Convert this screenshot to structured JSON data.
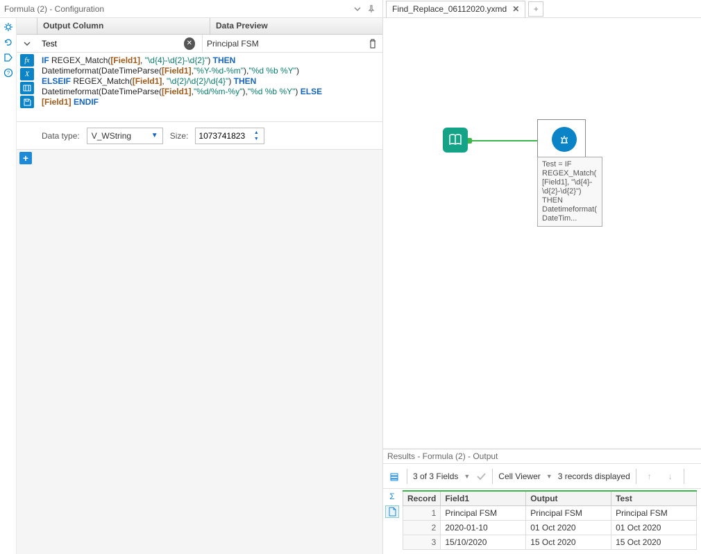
{
  "config": {
    "title": "Formula (2) - Configuration",
    "columns": {
      "output": "Output Column",
      "preview": "Data Preview"
    },
    "row": {
      "output_value": "Test",
      "preview_value": "Principal FSM"
    },
    "expression": {
      "lines": [
        {
          "t": [
            {
              "c": "kw-blue",
              "s": "IF "
            },
            {
              "c": "fn-black",
              "s": "REGEX_Match("
            },
            {
              "c": "field-brown",
              "s": "[Field1]"
            },
            {
              "c": "fn-black",
              "s": ", "
            },
            {
              "c": "str-teal",
              "s": "\"\\d{4}-\\d{2}-\\d{2}\""
            },
            {
              "c": "fn-black",
              "s": ") "
            },
            {
              "c": "kw-blue",
              "s": "THEN"
            }
          ]
        },
        {
          "t": [
            {
              "c": "fn-black",
              "s": "Datetimeformat(DateTimeParse("
            },
            {
              "c": "field-brown",
              "s": "[Field1]"
            },
            {
              "c": "fn-black",
              "s": ","
            },
            {
              "c": "str-teal",
              "s": "\"%Y-%d-%m\""
            },
            {
              "c": "fn-black",
              "s": "),"
            },
            {
              "c": "str-teal",
              "s": "\"%d %b %Y\""
            },
            {
              "c": "fn-black",
              "s": ")"
            }
          ]
        },
        {
          "t": [
            {
              "c": "kw-blue",
              "s": "ELSEIF "
            },
            {
              "c": "fn-black",
              "s": "REGEX_Match("
            },
            {
              "c": "field-brown",
              "s": "[Field1]"
            },
            {
              "c": "fn-black",
              "s": ", "
            },
            {
              "c": "str-teal",
              "s": "\"\\d{2}/\\d{2}/\\d{4}\""
            },
            {
              "c": "fn-black",
              "s": ") "
            },
            {
              "c": "kw-blue",
              "s": "THEN"
            }
          ]
        },
        {
          "t": [
            {
              "c": "fn-black",
              "s": "Datetimeformat(DateTimeParse("
            },
            {
              "c": "field-brown",
              "s": "[Field1]"
            },
            {
              "c": "fn-black",
              "s": ","
            },
            {
              "c": "str-teal",
              "s": "\"%d/%m-%y\""
            },
            {
              "c": "fn-black",
              "s": "),"
            },
            {
              "c": "str-teal",
              "s": "\"%d %b %Y\""
            },
            {
              "c": "fn-black",
              "s": ") "
            },
            {
              "c": "kw-blue",
              "s": "ELSE"
            }
          ]
        },
        {
          "t": [
            {
              "c": "field-brown",
              "s": "[Field1]"
            },
            {
              "c": "fn-black",
              "s": " "
            },
            {
              "c": "kw-blue",
              "s": "ENDIF"
            }
          ]
        }
      ]
    },
    "datatype_label": "Data type:",
    "datatype_value": "V_WString",
    "size_label": "Size:",
    "size_value": "1073741823"
  },
  "tabs": {
    "name": "Find_Replace_06112020.yxmd"
  },
  "canvas": {
    "node_label": "Test = IF REGEX_Match([Field1], \"\\d{4}-\\d{2}-\\d{2}\") THEN Datetimeformat(DateTim..."
  },
  "results": {
    "title": "Results - Formula (2) - Output",
    "fields_text": "3 of 3 Fields",
    "cellviewer": "Cell Viewer",
    "records_text": "3 records displayed",
    "headers": [
      "Record",
      "Field1",
      "Output",
      "Test"
    ],
    "rows": [
      {
        "n": "1",
        "f": "Principal FSM",
        "o": "Principal FSM",
        "t": "Principal FSM"
      },
      {
        "n": "2",
        "f": "2020-01-10",
        "o": "01 Oct 2020",
        "t": "01 Oct 2020"
      },
      {
        "n": "3",
        "f": "15/10/2020",
        "o": "15 Oct 2020",
        "t": "15 Oct 2020"
      }
    ]
  }
}
